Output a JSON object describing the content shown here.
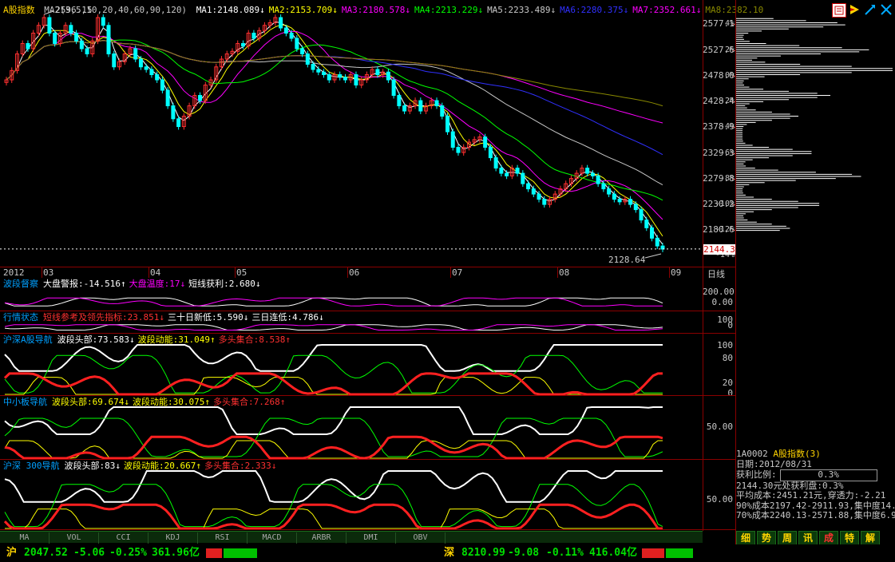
{
  "chart_data": {
    "type": "candlestick",
    "title": "A股指数",
    "period": "日线",
    "ma_params": "MA2(3,5,10,20,40,60,90,120)",
    "ma_values": [
      {
        "label": "MA1:2148.089↓",
        "color": "#ffffff"
      },
      {
        "label": "MA2:2153.709↓",
        "color": "#ffff00"
      },
      {
        "label": "MA3:2180.578↓",
        "color": "#ff00ff"
      },
      {
        "label": "MA4:2213.229↓",
        "color": "#00ff00"
      },
      {
        "label": "MA5:2233.489↓",
        "color": "#c8c8c8"
      },
      {
        "label": "MA6:2280.375↓",
        "color": "#3030ff"
      },
      {
        "label": "MA7:2352.661↓",
        "color": "#ff00ff"
      },
      {
        "label": "MA8:2382.10",
        "color": "#888800"
      }
    ],
    "y_ticks": [
      "2577.1",
      "2527.6",
      "2478.0",
      "2428.4",
      "2378.9",
      "2329.3",
      "2279.8",
      "2230.2",
      "2180.6"
    ],
    "pct_ticks": [
      "4%",
      "2%",
      "0%",
      "-2%",
      "-4%",
      "-6%",
      "-8%",
      "-10%",
      "-12%",
      "-14%"
    ],
    "current_price": "2144.3",
    "max_label": "2596.15",
    "min_label": "2128.64",
    "months": [
      "2012",
      "03",
      "04",
      "05",
      "06",
      "07",
      "08",
      "09"
    ],
    "ylim": [
      2128.64,
      2596.15
    ],
    "close": [
      2470,
      2488,
      2520,
      2540,
      2530,
      2560,
      2575,
      2590,
      2560,
      2540,
      2560,
      2575,
      2560,
      2545,
      2530,
      2520,
      2545,
      2590,
      2575,
      2520,
      2495,
      2505,
      2520,
      2530,
      2510,
      2495,
      2490,
      2480,
      2470,
      2450,
      2420,
      2395,
      2380,
      2400,
      2420,
      2440,
      2430,
      2460,
      2470,
      2495,
      2510,
      2520,
      2525,
      2540,
      2535,
      2560,
      2550,
      2565,
      2575,
      2580,
      2590,
      2570,
      2560,
      2550,
      2530,
      2520,
      2500,
      2490,
      2485,
      2480,
      2470,
      2480,
      2475,
      2470,
      2480,
      2460,
      2470,
      2480,
      2490,
      2480,
      2485,
      2470,
      2440,
      2420,
      2410,
      2420,
      2430,
      2410,
      2420,
      2430,
      2420,
      2400,
      2370,
      2340,
      2330,
      2340,
      2350,
      2355,
      2360,
      2340,
      2320,
      2300,
      2290,
      2285,
      2300,
      2290,
      2270,
      2260,
      2250,
      2240,
      2230,
      2240,
      2250,
      2260,
      2270,
      2280,
      2290,
      2300,
      2290,
      2285,
      2270,
      2260,
      2250,
      2240,
      2235,
      2240,
      2230,
      2220,
      2200,
      2185,
      2165,
      2150,
      2144
    ]
  },
  "header": {
    "title": "A股指数",
    "icons": [
      "tool-icon",
      "video-icon",
      "arrow-icon",
      "tool-x-icon"
    ]
  },
  "indicators": [
    {
      "name": "波段督察",
      "parts": [
        {
          "t": "大盘警报:-14.516↑",
          "c": "#ffffff"
        },
        {
          "t": "大盘温度:17↓",
          "c": "#ff00ff"
        },
        {
          "t": "短线获利:2.680↓",
          "c": "#ffffff"
        }
      ],
      "ticks": [
        "200.00",
        "0.00"
      ]
    },
    {
      "name": "行情状态",
      "parts": [
        {
          "t": "短线参考及领先指标:23.851↓",
          "c": "#ff3030"
        },
        {
          "t": "三十日新低:5.590↓",
          "c": "#ffffff"
        },
        {
          "t": "三日连低:4.786↓",
          "c": "#ffffff"
        }
      ],
      "ticks": [
        "100",
        "0"
      ]
    },
    {
      "name": "沪深A股导航",
      "parts": [
        {
          "t": "波段头部:73.583↓",
          "c": "#ffffff"
        },
        {
          "t": "波段动能:31.049↑",
          "c": "#ffff00"
        },
        {
          "t": "多头集合:8.538↑",
          "c": "#ff3030"
        }
      ],
      "ticks": [
        "100",
        "80",
        "20",
        "0"
      ]
    },
    {
      "name": "中小板导航",
      "parts": [
        {
          "t": "波段头部:69.674↓",
          "c": "#ffff00"
        },
        {
          "t": "波段动能:30.075↑",
          "c": "#ffff00"
        },
        {
          "t": "多头集合:7.268↑",
          "c": "#ff3030"
        }
      ],
      "ticks": [
        "50.00"
      ]
    },
    {
      "name": "沪深 300导航",
      "parts": [
        {
          "t": "波段头部:83↓",
          "c": "#ffffff"
        },
        {
          "t": "波段动能:20.667↑",
          "c": "#ffff00"
        },
        {
          "t": "多头集合:2.333↓",
          "c": "#ff3030"
        }
      ],
      "ticks": [
        "50.00"
      ]
    }
  ],
  "bottom_tabs": [
    "MA",
    "VOL",
    "CCI",
    "KDJ",
    "RSI",
    "MACD",
    "ARBR",
    "DMI",
    "OBV"
  ],
  "right_panel": {
    "code": "1A0002",
    "name": "A股指数(3)",
    "date": "日期:2012/08/31",
    "ratio_label": "获利比例:",
    "ratio_value": "0.3%",
    "lines": [
      "2144.30元处获利盘:0.3%",
      "平均成本:2451.21元,穿透力:-2.21",
      "90%成本2197.42-2911.93,集中度14.0",
      "70%成本2240.13-2571.88,集中度6.9"
    ]
  },
  "right_tabs": [
    "细",
    "势",
    "周",
    "讯",
    "成",
    "特",
    "解"
  ],
  "status": {
    "sh_label": "沪",
    "sh_index": "2047.52",
    "sh_change": "-5.06",
    "sh_pct": "-0.25%",
    "sh_amount": "361.96亿",
    "sz_label": "深",
    "sz_index": "8210.99",
    "sz_change": "-9.08",
    "sz_pct": "-0.11%",
    "sz_amount": "416.04亿"
  }
}
